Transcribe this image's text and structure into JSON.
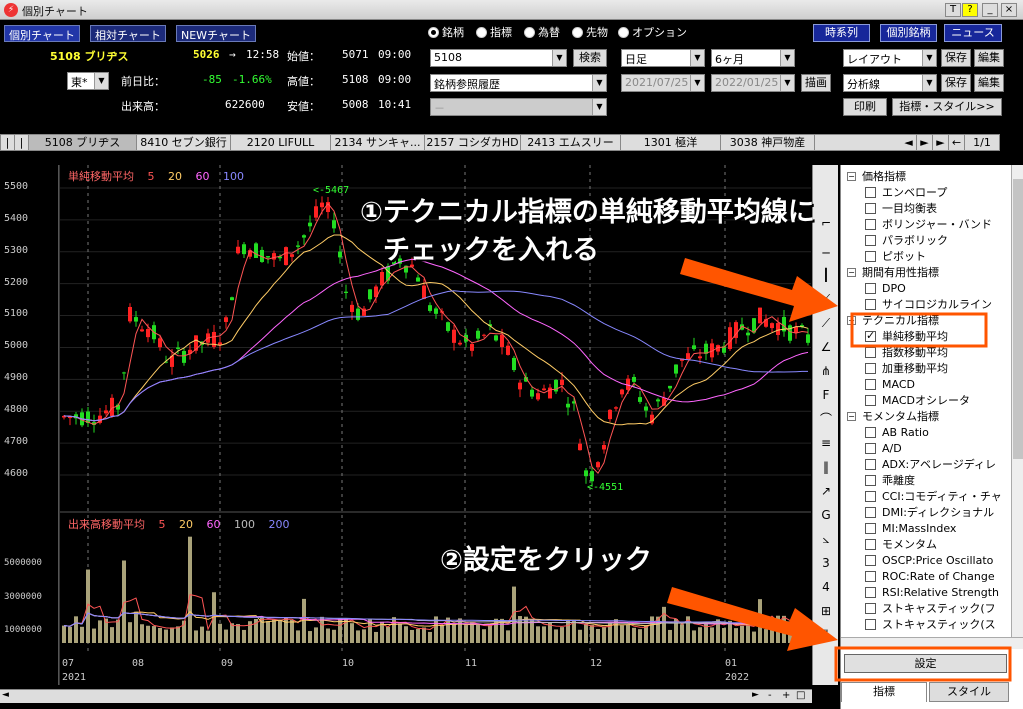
{
  "window": {
    "title": "個別チャート",
    "buttons": [
      "T",
      "?",
      "_",
      "×"
    ]
  },
  "tabs": [
    {
      "label": "個別チャート",
      "active": true
    },
    {
      "label": "相対チャート",
      "active": false
    },
    {
      "label": "NEWチャート",
      "active": false
    }
  ],
  "radio": [
    {
      "label": "銘柄",
      "on": true
    },
    {
      "label": "指標",
      "on": false
    },
    {
      "label": "為替",
      "on": false
    },
    {
      "label": "先物",
      "on": false
    },
    {
      "label": "オプション",
      "on": false
    }
  ],
  "right_buttons": {
    "timeseries": "時系列",
    "stock_info": "個別銘柄",
    "news": "ニュース",
    "save1": "保存",
    "edit1": "編集",
    "save2": "保存",
    "edit2": "編集",
    "print": "印刷",
    "indicator_style": "指標・スタイル>>",
    "draw": "描画",
    "search": "検索"
  },
  "quote": {
    "code_name": "5108 ブリヂス",
    "price": "5026",
    "arrow": "→",
    "time": "12:58",
    "open_label": "始値：",
    "open": "5071",
    "open_time": "09:00",
    "change_label": "前日比：",
    "change": "-85",
    "change_pct": "-1.66%",
    "high_label": "高値：",
    "high": "5108",
    "high_time": "09:00",
    "volume_label": "出来高：",
    "volume": "622600",
    "low_label": "安値：",
    "low": "5008",
    "low_time": "10:41",
    "exchange": "東*"
  },
  "inputs": {
    "code": "5108",
    "history": "銘柄参照履歴",
    "blank": "－",
    "period": "日足",
    "range": "6ヶ月",
    "from": "2021/07/25",
    "to": "2022/01/25",
    "layout": "レイアウト",
    "analysis": "分析線"
  },
  "stock_strip": {
    "items": [
      "5108 ブリヂス",
      "8410 セブン銀行",
      "2120 LIFULL",
      "2134 サンキャ...",
      "2157 コシダカHD",
      "2413 エムスリー",
      "1301 極洋",
      "3038 神戸物産"
    ],
    "page": "1/1"
  },
  "price_chart": {
    "legend_title": "単純移動平均",
    "periods": [
      "5",
      "20",
      "60",
      "100"
    ],
    "period_colors": [
      "#ff5555",
      "#ffcc66",
      "#ff66ff",
      "#8888ff"
    ],
    "high_marker": "<-5467",
    "low_marker": "<-4551",
    "y_ticks": [
      "5500",
      "5400",
      "5300",
      "5200",
      "5100",
      "5000",
      "4900",
      "4800",
      "4700",
      "4600"
    ]
  },
  "volume_chart": {
    "legend_title": "出来高移動平均",
    "periods": [
      "5",
      "20",
      "60",
      "100",
      "200"
    ],
    "period_colors": [
      "#ff5555",
      "#ffcc66",
      "#ff66ff",
      "#bbbbbb",
      "#8888ff"
    ],
    "y_ticks": [
      "5000000",
      "3000000",
      "1000000"
    ]
  },
  "x_axis": {
    "months": [
      "07",
      "08",
      "09",
      "10",
      "11",
      "12",
      "01"
    ],
    "years": [
      "2021",
      "2022"
    ]
  },
  "tree": [
    {
      "type": "group",
      "label": "価格指標"
    },
    {
      "type": "item",
      "label": "エンベロープ",
      "checked": false
    },
    {
      "type": "item",
      "label": "一目均衡表",
      "checked": false
    },
    {
      "type": "item",
      "label": "ボリンジャー・バンド",
      "checked": false
    },
    {
      "type": "item",
      "label": "パラボリック",
      "checked": false
    },
    {
      "type": "item",
      "label": "ピボット",
      "checked": false
    },
    {
      "type": "group",
      "label": "期間有用性指標"
    },
    {
      "type": "item",
      "label": "DPO",
      "checked": false
    },
    {
      "type": "item",
      "label": "サイコロジカルライン",
      "checked": false
    },
    {
      "type": "group",
      "label": "テクニカル指標"
    },
    {
      "type": "item",
      "label": "単純移動平均",
      "checked": true
    },
    {
      "type": "item",
      "label": "指数移動平均",
      "checked": false
    },
    {
      "type": "item",
      "label": "加重移動平均",
      "checked": false
    },
    {
      "type": "item",
      "label": "MACD",
      "checked": false
    },
    {
      "type": "item",
      "label": "MACDオシレータ",
      "checked": false
    },
    {
      "type": "group",
      "label": "モメンタム指標"
    },
    {
      "type": "item",
      "label": "AB Ratio",
      "checked": false
    },
    {
      "type": "item",
      "label": "A/D",
      "checked": false
    },
    {
      "type": "item",
      "label": "ADX:アベレージディレ",
      "checked": false
    },
    {
      "type": "item",
      "label": "乖離度",
      "checked": false
    },
    {
      "type": "item",
      "label": "CCI:コモディティ・チャ",
      "checked": false
    },
    {
      "type": "item",
      "label": "DMI:ディレクショナル",
      "checked": false
    },
    {
      "type": "item",
      "label": "MI:MassIndex",
      "checked": false
    },
    {
      "type": "item",
      "label": "モメンタム",
      "checked": false
    },
    {
      "type": "item",
      "label": "OSCP:Price Oscillato",
      "checked": false
    },
    {
      "type": "item",
      "label": "ROC:Rate of Change",
      "checked": false
    },
    {
      "type": "item",
      "label": "RSI:Relative Strength",
      "checked": false
    },
    {
      "type": "item",
      "label": "ストキャスティック(フ",
      "checked": false
    },
    {
      "type": "item",
      "label": "ストキャスティック(ス",
      "checked": false
    }
  ],
  "panel": {
    "settings_button": "設定",
    "tab_indicator": "指標",
    "tab_style": "スタイル"
  },
  "annotations": {
    "step1_line1": "①テクニカル指標の単純移動平均線に",
    "step1_line2": "チェックを入れる",
    "step2": "②設定をクリック",
    "color": "#ff5500"
  }
}
